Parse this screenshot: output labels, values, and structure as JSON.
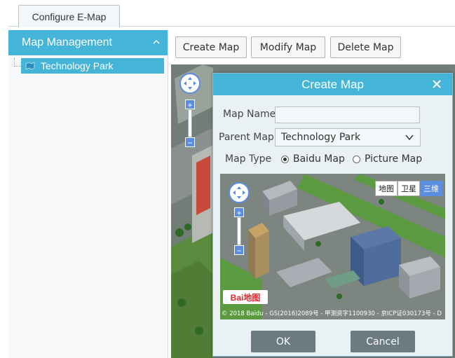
{
  "tabs": [
    {
      "label": "Configure E-Map",
      "active": true
    }
  ],
  "sidebar": {
    "header": "Map Management",
    "header_icon": "chevron-up-icon",
    "tree": [
      {
        "label": "Technology Park",
        "icon": "map-folder-icon",
        "selected": true
      }
    ]
  },
  "toolbar": {
    "create_label": "Create Map",
    "modify_label": "Modify Map",
    "delete_label": "Delete Map"
  },
  "dialog": {
    "title": "Create Map",
    "close_icon": "close-icon",
    "map_name_label": "Map Name",
    "map_name_value": "",
    "parent_map_label": "Parent Map",
    "parent_map_value": "Technology Park",
    "map_type_label": "Map Type",
    "map_type_options": [
      {
        "label": "Baidu Map",
        "checked": true
      },
      {
        "label": "Picture Map",
        "checked": false
      }
    ],
    "preview": {
      "map_types": [
        "地图",
        "卫星",
        "三维"
      ],
      "active_map_type": "三维",
      "logo": "Bai地图",
      "copyright": "© 2018 Baidu - GS(2016)2089号 - 甲测资字1100930 - 京ICP证030173号 - D"
    },
    "ok_label": "OK",
    "cancel_label": "Cancel"
  },
  "colors": {
    "accent": "#44b4d8",
    "dialog_bg": "#e9f1f5",
    "button_dark": "#6c7a82",
    "map_blue": "#5b8ee0"
  }
}
